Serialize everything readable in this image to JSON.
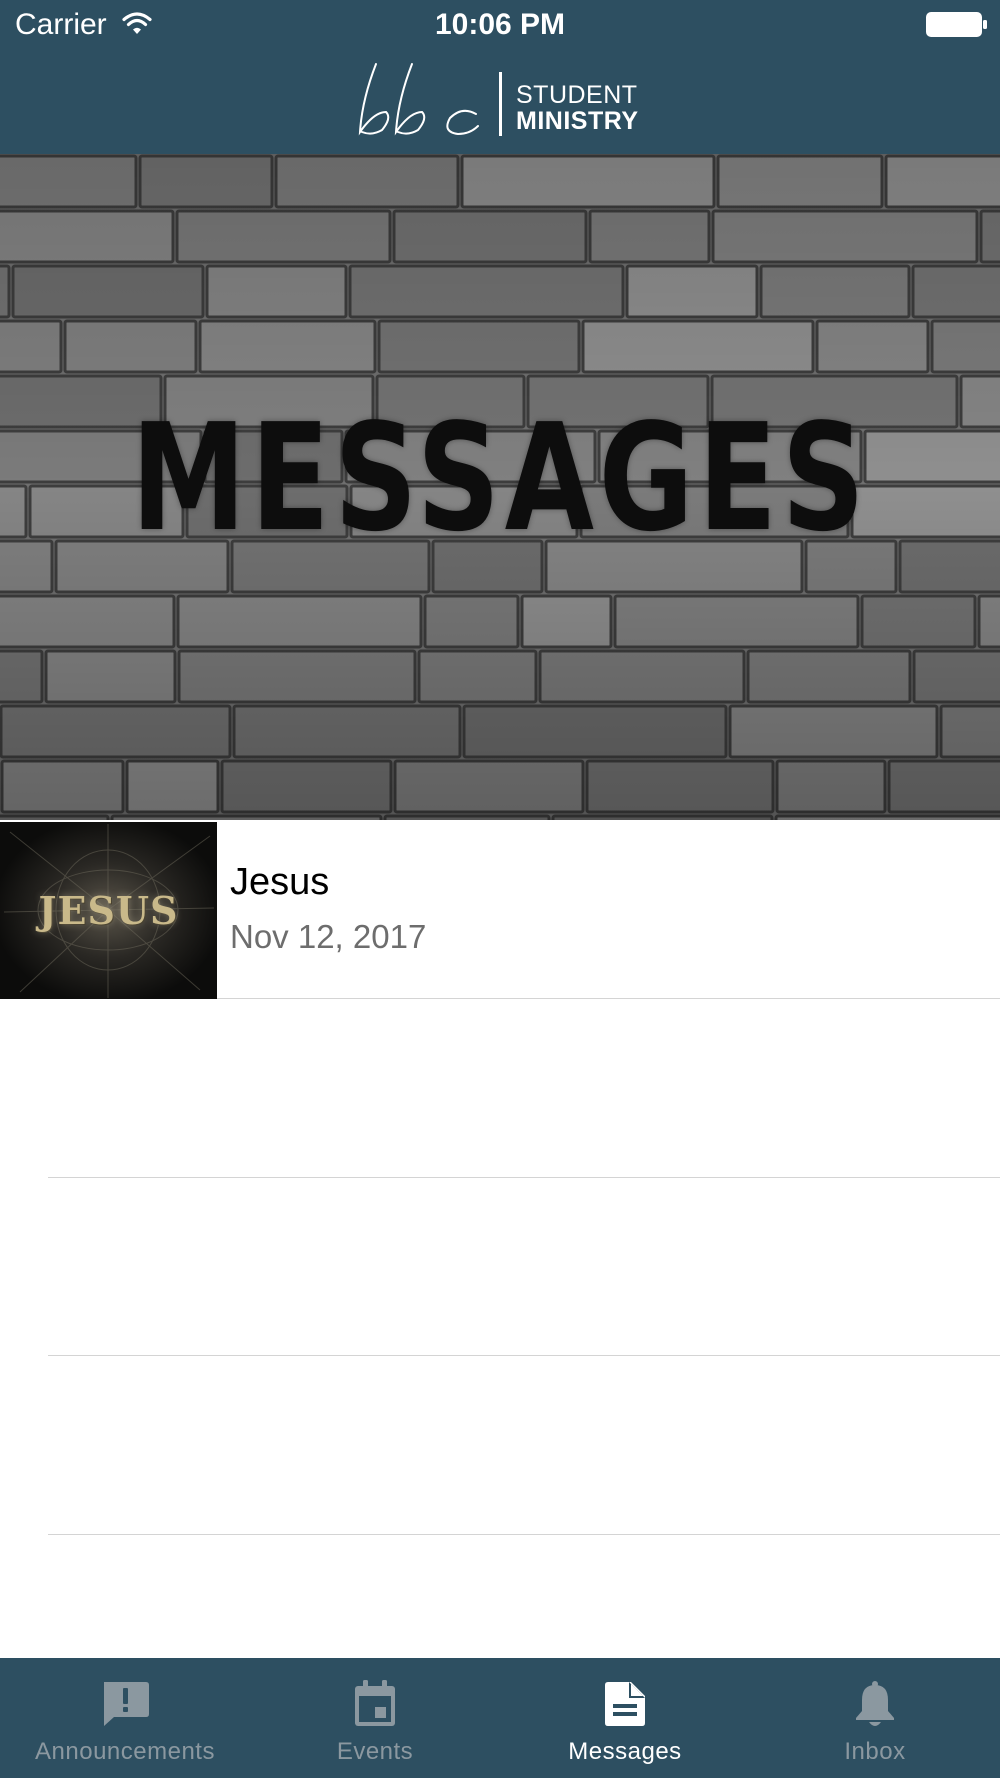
{
  "status_bar": {
    "carrier": "Carrier",
    "time": "10:06 PM"
  },
  "header": {
    "logo_line1": "STUDENT",
    "logo_line2": "MINISTRY",
    "logo_mark": "bbc"
  },
  "hero": {
    "title": "MESSAGES"
  },
  "messages": [
    {
      "thumbnail_text": "JESUS",
      "title": "Jesus",
      "date": "Nov 12, 2017"
    }
  ],
  "tabs": [
    {
      "label": "Announcements",
      "icon": "announcement-icon",
      "active": false
    },
    {
      "label": "Events",
      "icon": "calendar-icon",
      "active": false
    },
    {
      "label": "Messages",
      "icon": "document-icon",
      "active": true
    },
    {
      "label": "Inbox",
      "icon": "bell-icon",
      "active": false
    }
  ],
  "colors": {
    "header_bg": "#2d4f61",
    "tab_inactive": "#8b98a0",
    "tab_active": "#ffffff"
  }
}
